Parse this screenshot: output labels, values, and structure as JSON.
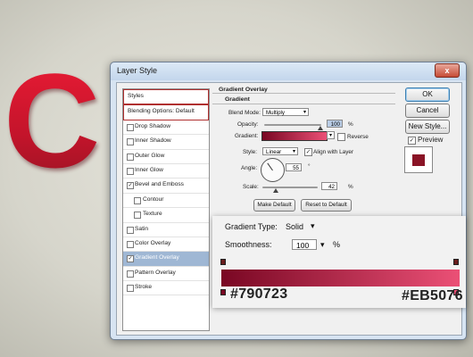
{
  "decor": {
    "big_letter": "C"
  },
  "dialog": {
    "title": "Layer Style",
    "close_glyph": "x",
    "styles_list": [
      {
        "label": "Styles",
        "checkbox": false,
        "checked": false
      },
      {
        "label": "Blending Options: Default",
        "checkbox": false,
        "checked": false
      },
      {
        "label": "Drop Shadow",
        "checkbox": true,
        "checked": false
      },
      {
        "label": "Inner Shadow",
        "checkbox": true,
        "checked": false
      },
      {
        "label": "Outer Glow",
        "checkbox": true,
        "checked": false
      },
      {
        "label": "Inner Glow",
        "checkbox": true,
        "checked": false
      },
      {
        "label": "Bevel and Emboss",
        "checkbox": true,
        "checked": true
      },
      {
        "label": "Contour",
        "checkbox": true,
        "checked": false
      },
      {
        "label": "Texture",
        "checkbox": true,
        "checked": false
      },
      {
        "label": "Satin",
        "checkbox": true,
        "checked": false
      },
      {
        "label": "Color Overlay",
        "checkbox": true,
        "checked": false
      },
      {
        "label": "Gradient Overlay",
        "checkbox": true,
        "checked": true
      },
      {
        "label": "Pattern Overlay",
        "checkbox": true,
        "checked": false
      },
      {
        "label": "Stroke",
        "checkbox": true,
        "checked": false
      }
    ],
    "section_title": "Gradient Overlay",
    "group_title": "Gradient",
    "blend_mode_label": "Blend Mode:",
    "blend_mode_value": "Multiply",
    "opacity_label": "Opacity:",
    "opacity_value": "100",
    "opacity_unit": "%",
    "gradient_label": "Gradient:",
    "reverse_label": "Reverse",
    "style_label": "Style:",
    "style_value": "Linear",
    "align_label": "Align with Layer",
    "angle_label": "Angle:",
    "angle_value": "55",
    "angle_unit": "°",
    "scale_label": "Scale:",
    "scale_value": "42",
    "scale_unit": "%",
    "make_default": "Make Default",
    "reset_default": "Reset to Default",
    "ok": "OK",
    "cancel": "Cancel",
    "new_style": "New Style...",
    "preview_label": "Preview",
    "preview_checked": true
  },
  "zoom_panel": {
    "gradient_type_label": "Gradient Type:",
    "gradient_type_value": "Solid",
    "smoothness_label": "Smoothness:",
    "smoothness_value": "100",
    "smoothness_unit": "%",
    "color_start": "#790723",
    "color_end": "#EB5076"
  },
  "colors": {
    "gradient_start": "#790723",
    "gradient_end": "#EB5076",
    "accent_red": "#d11a33"
  }
}
